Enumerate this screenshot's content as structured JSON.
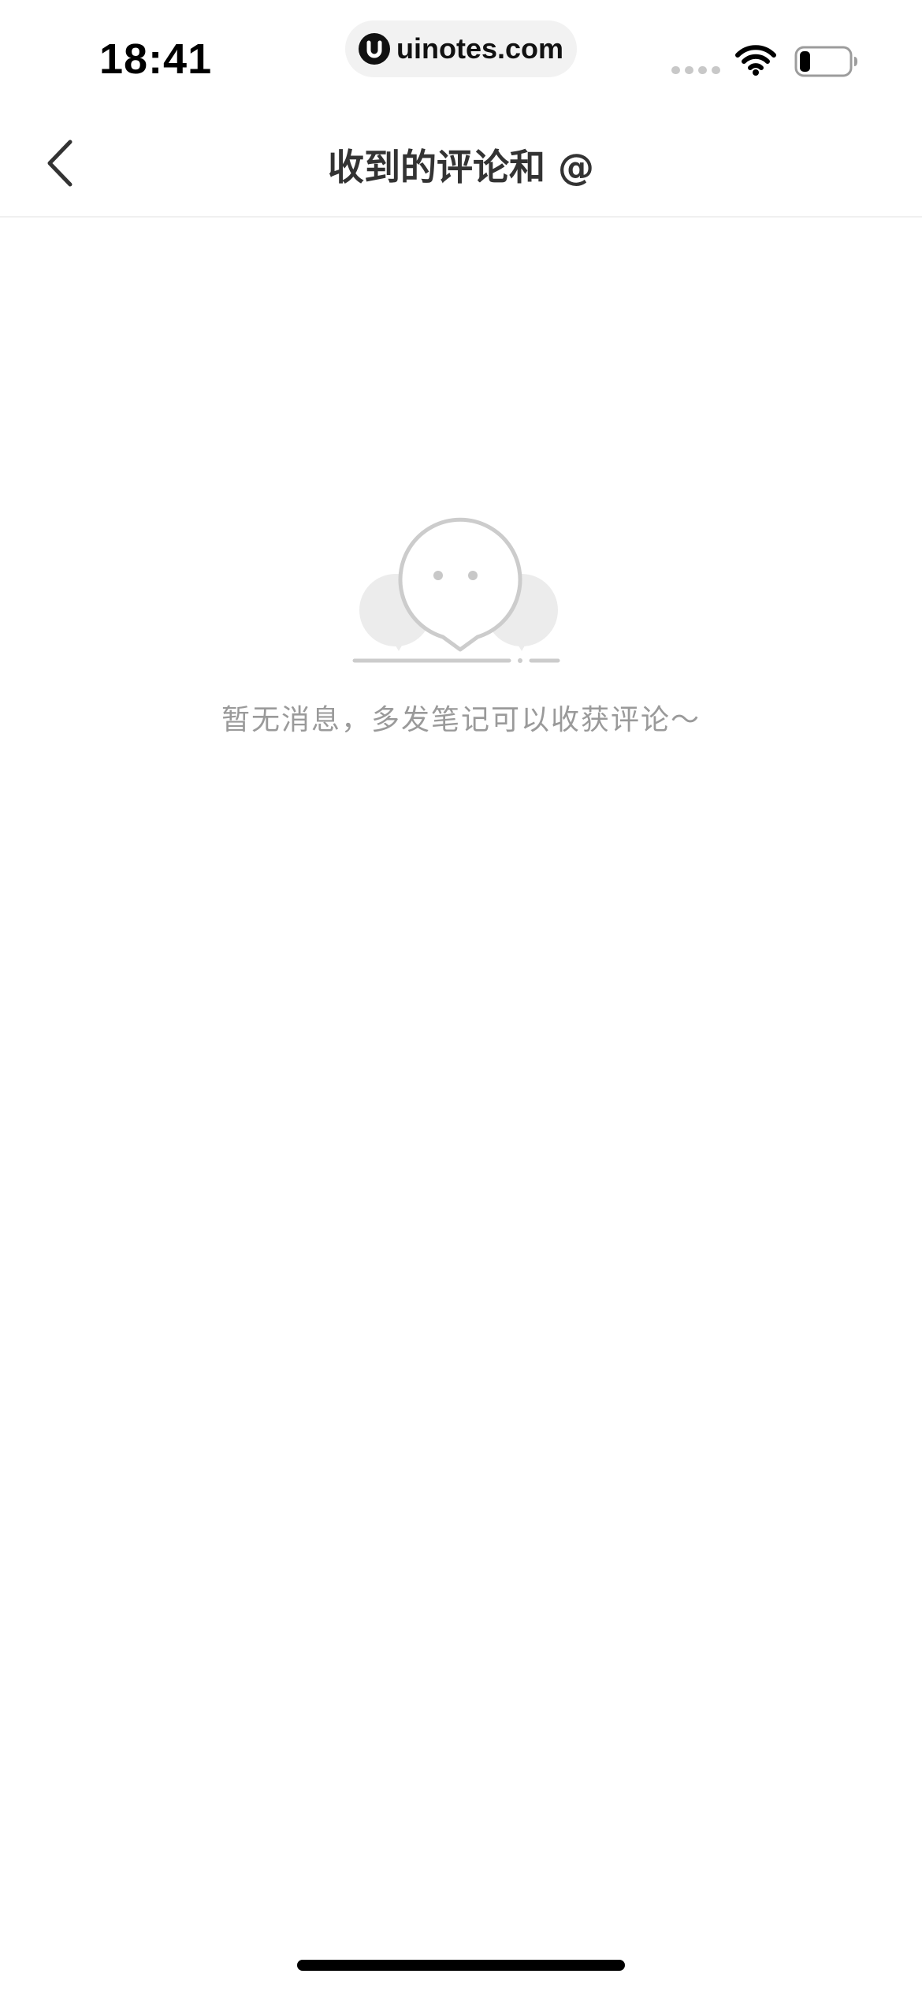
{
  "status_bar": {
    "time": "18:41",
    "url": "uinotes.com",
    "icons": [
      "cellular-signal-icon",
      "wifi-icon",
      "battery-icon"
    ],
    "battery_level": 0.22
  },
  "nav": {
    "title": "收到的评论和 @",
    "back_icon": "chevron-left-icon"
  },
  "empty_state": {
    "icon": "chat-bubble-face-icon",
    "message": "暂无消息，多发笔记可以收获评论～"
  },
  "colors": {
    "background": "#ffffff",
    "title": "#333333",
    "empty_text": "#9a9a9a",
    "illustration_stroke": "#cccccc",
    "illustration_fill": "#ececec"
  }
}
